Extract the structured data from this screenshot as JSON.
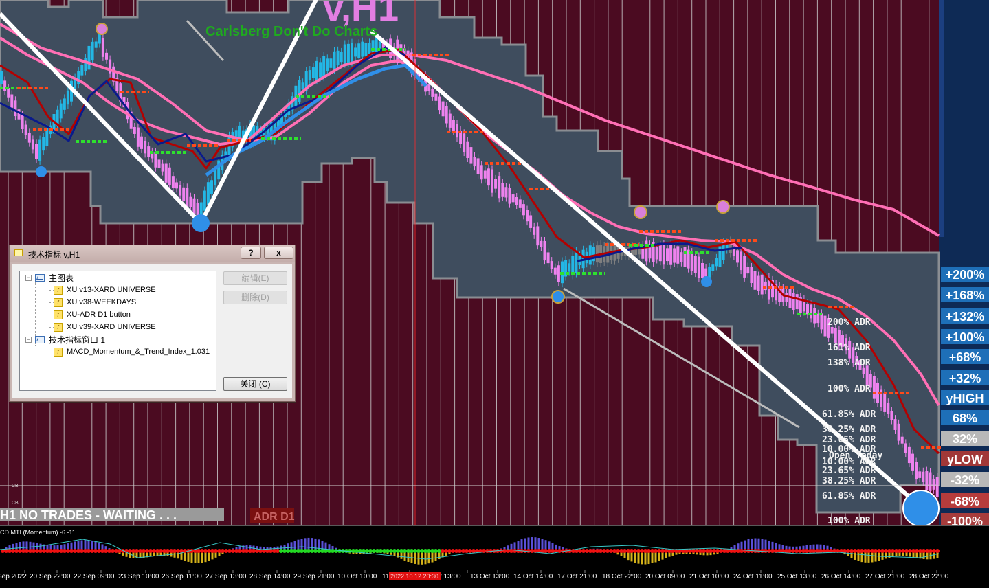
{
  "chart": {
    "watermark": "v,H1",
    "brand": "Carlsberg Don't Do Charts",
    "no_trades": "H1  NO TRADES - WAITING . . .",
    "adr_button": "ADR D1",
    "subwindow_label": "CD MTI (Momentum) -6 -11",
    "cursor_time": "2022.10.12 20:30",
    "time_labels": [
      "Sep 2022",
      "20 Sep 22:00",
      "22 Sep 09:00",
      "23 Sep 10:00",
      "26 Sep 11:00",
      "27 Sep 13:00",
      "28 Sep 14:00",
      "29 Sep 21:00",
      "10 Oct 10:00",
      "11",
      "t 13:00",
      "13 Oct 13:00",
      "14 Oct 14:00",
      "17 Oct 21:00",
      "18 Oct 22:00",
      "20 Oct 09:00",
      "21 Oct 10:00",
      "24 Oct 11:00",
      "25 Oct 13:00",
      "26 Oct 14:00",
      "27 Oct 21:00",
      "28 Oct 22:00"
    ],
    "small_marks": [
      "CB",
      "CB"
    ],
    "adr_levels": [
      "200% ADR",
      "161% ADR",
      "138% ADR",
      "100% ADR",
      "61.85% ADR",
      "38.25% ADR",
      "23.65% ADR",
      "10.00% ADR",
      "Open Today",
      "10.00% ADR",
      "23.65% ADR",
      "38.25% ADR",
      "61.85% ADR",
      "100% ADR"
    ],
    "right_labels": [
      "+200%",
      "+168%",
      "+132%",
      "+100%",
      "+68%",
      "+32%",
      "yHIGH",
      "68%",
      "32%",
      "yLOW",
      "-32%",
      "-68%",
      "-100%"
    ]
  },
  "colors": {
    "background": "#4b0b21",
    "channel": "#3f4d5e",
    "channel_border": "#8a8d92",
    "bull_candle": "#23b7e5",
    "bear_candle": "#ee82ee",
    "neutral_candle": "#7f7f7f",
    "ma_red": "#b30000",
    "ma_navy": "#0a1a8c",
    "ma_blue": "#2f8fe8",
    "ma_pink": "#ff6fb5",
    "zigzag": "#ffffff",
    "panel_right": "#0e2a55",
    "label_blue": "#1e6fb8",
    "label_red": "#b24545",
    "subwindow_bg": "#000000"
  },
  "dialog": {
    "title": "技术指标 v,H1",
    "help": "?",
    "close_x": "x",
    "main_chart": "主图表",
    "main_items": [
      "XU v13-XARD UNIVERSE",
      "XU v38-WEEKDAYS",
      "XU-ADR D1 button",
      "XU v39-XARD UNIVERSE"
    ],
    "indicator_window": "技术指标窗口 1",
    "window_items": [
      "MACD_Momentum_&_Trend_Index_1.031"
    ],
    "edit": "编辑(E)",
    "delete": "删除(D)",
    "close": "关闭 (C)"
  }
}
